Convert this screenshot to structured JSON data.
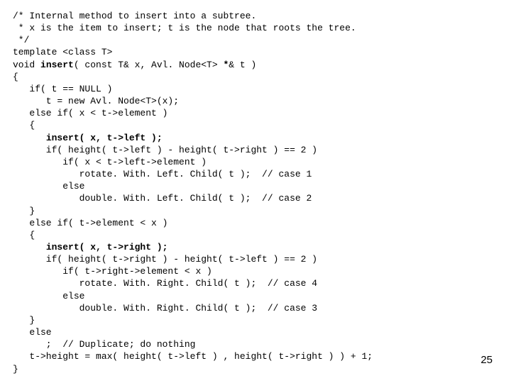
{
  "code": {
    "l01": "/* Internal method to insert into a subtree.",
    "l02": " * x is the item to insert; t is the node that roots the tree.",
    "l03": " */",
    "l04": "template <class T>",
    "l05a": "void ",
    "l05b": "insert",
    "l05c": "( const T& x, Avl. Node<T> ",
    "l05d": "*",
    "l05e": "& t )",
    "l06": "{",
    "l07": "   if( t == NULL )",
    "l08": "      t = new Avl. Node<T>(x);",
    "l09": "   else if( x < t->element )",
    "l10": "   {",
    "l11a": "      ",
    "l11b": "insert( x, t->left );",
    "l12": "      if( height( t->left ) - height( t->right ) == 2 )",
    "l13": "         if( x < t->left->element )",
    "l14": "            rotate. With. Left. Child( t );  // case 1",
    "l15": "         else",
    "l16": "            double. With. Left. Child( t );  // case 2",
    "l17": "   }",
    "l18": "   else if( t->element < x )",
    "l19": "   {",
    "l20a": "      ",
    "l20b": "insert( x, t->right );",
    "l21": "      if( height( t->right ) - height( t->left ) == 2 )",
    "l22": "         if( t->right->element < x )",
    "l23": "            rotate. With. Right. Child( t );  // case 4",
    "l24": "         else",
    "l25": "            double. With. Right. Child( t );  // case 3",
    "l26": "   }",
    "l27": "   else",
    "l28": "      ;  // Duplicate; do nothing",
    "l29": "   t->height = max( height( t->left ) , height( t->right ) ) + 1;",
    "l30": "}"
  },
  "page_number": "25"
}
